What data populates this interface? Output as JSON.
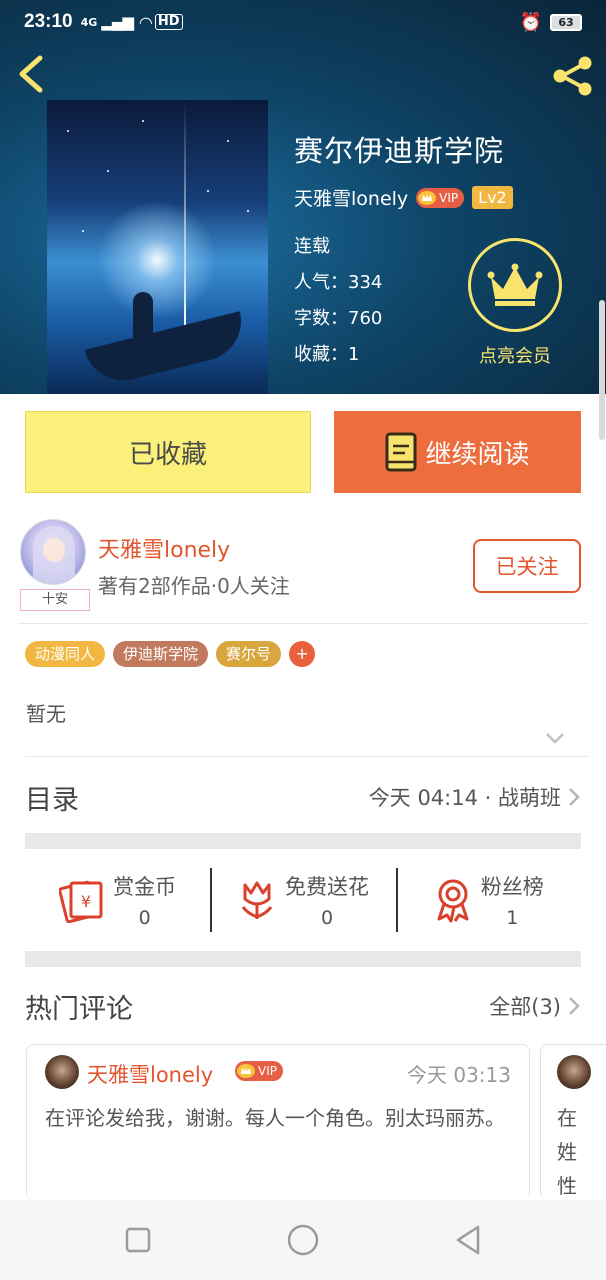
{
  "status_bar": {
    "time": "23:10",
    "network": "4G",
    "hd": "HD",
    "battery": "63"
  },
  "book": {
    "title": "赛尔伊迪斯学院",
    "author": "天雅雪lonely",
    "vip_label": "VIP",
    "level": "Lv2",
    "status": "连载",
    "popularity": "人气：334",
    "words": "字数：760",
    "favorites": "收藏：1",
    "member_label": "点亮会员"
  },
  "actions": {
    "collected_label": "已收藏",
    "read_label": "继续阅读"
  },
  "author_card": {
    "name": "天雅雪lonely",
    "meta": "著有2部作品·0人关注",
    "avatar_tag": "十安",
    "follow_label": "已关注"
  },
  "tags": {
    "items": [
      {
        "label": "动漫同人",
        "color": "#f2b740"
      },
      {
        "label": "伊迪斯学院",
        "color": "#c27a5e"
      },
      {
        "label": "赛尔号",
        "color": "#d9a63e"
      }
    ],
    "add_label": "+"
  },
  "description": "暂无",
  "toc": {
    "title": "目录",
    "latest": "今天 04:14 · 战萌班"
  },
  "stats": {
    "reward": {
      "label": "赏金币",
      "value": "0"
    },
    "flower": {
      "label": "免费送花",
      "value": "0"
    },
    "fans": {
      "label": "粉丝榜",
      "value": "1"
    }
  },
  "hot_comments": {
    "title": "热门评论",
    "all_label": "全部(3)",
    "items": [
      {
        "user": "天雅雪lonely",
        "vip": "VIP",
        "time": "今天 03:13",
        "text": "在评论发给我，谢谢。每人一个角色。别太玛丽苏。"
      },
      {
        "text": "在姓性"
      }
    ]
  },
  "colors": {
    "accent_orange": "#ed6d3f",
    "collected_yellow": "#faf07a",
    "author_red": "#e2552f",
    "member_yellow": "#f8e36c"
  }
}
